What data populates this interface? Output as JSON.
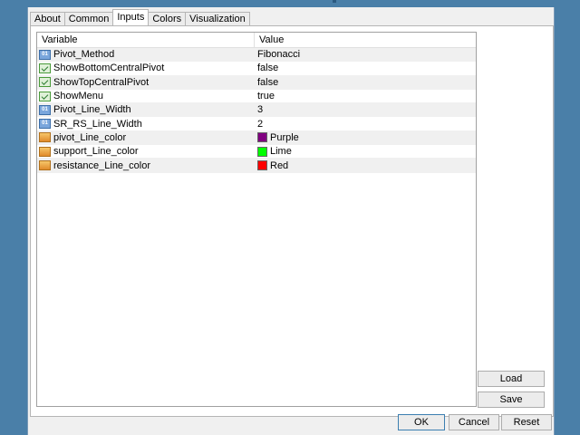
{
  "tabs": [
    "About",
    "Common",
    "Inputs",
    "Colors",
    "Visualization"
  ],
  "active_tab": "Inputs",
  "table": {
    "headers": [
      "Variable",
      "Value"
    ],
    "rows": [
      {
        "name": "Pivot_Method",
        "value": "Fibonacci",
        "icon": "numeric-param-icon"
      },
      {
        "name": "ShowBottomCentralPivot",
        "value": "false",
        "icon": "boolean-param-icon"
      },
      {
        "name": "ShowTopCentralPivot",
        "value": "false",
        "icon": "boolean-param-icon"
      },
      {
        "name": "ShowMenu",
        "value": "true",
        "icon": "boolean-param-icon"
      },
      {
        "name": "Pivot_Line_Width",
        "value": "3",
        "icon": "numeric-param-icon"
      },
      {
        "name": "SR_RS_Line_Width",
        "value": "2",
        "icon": "numeric-param-icon"
      },
      {
        "name": "pivot_Line_color",
        "value": "Purple",
        "icon": "color-param-icon",
        "swatch": "#800080"
      },
      {
        "name": "support_Line_color",
        "value": "Lime",
        "icon": "color-param-icon",
        "swatch": "#00ff00"
      },
      {
        "name": "resistance_Line_color",
        "value": "Red",
        "icon": "color-param-icon",
        "swatch": "#ff0000"
      }
    ]
  },
  "side_buttons": {
    "load": "Load",
    "save": "Save"
  },
  "footer_buttons": {
    "ok": "OK",
    "cancel": "Cancel",
    "reset": "Reset"
  },
  "colors": {
    "titlebar": "#4a7fa8",
    "default_button_border": "#3c7fb1"
  }
}
